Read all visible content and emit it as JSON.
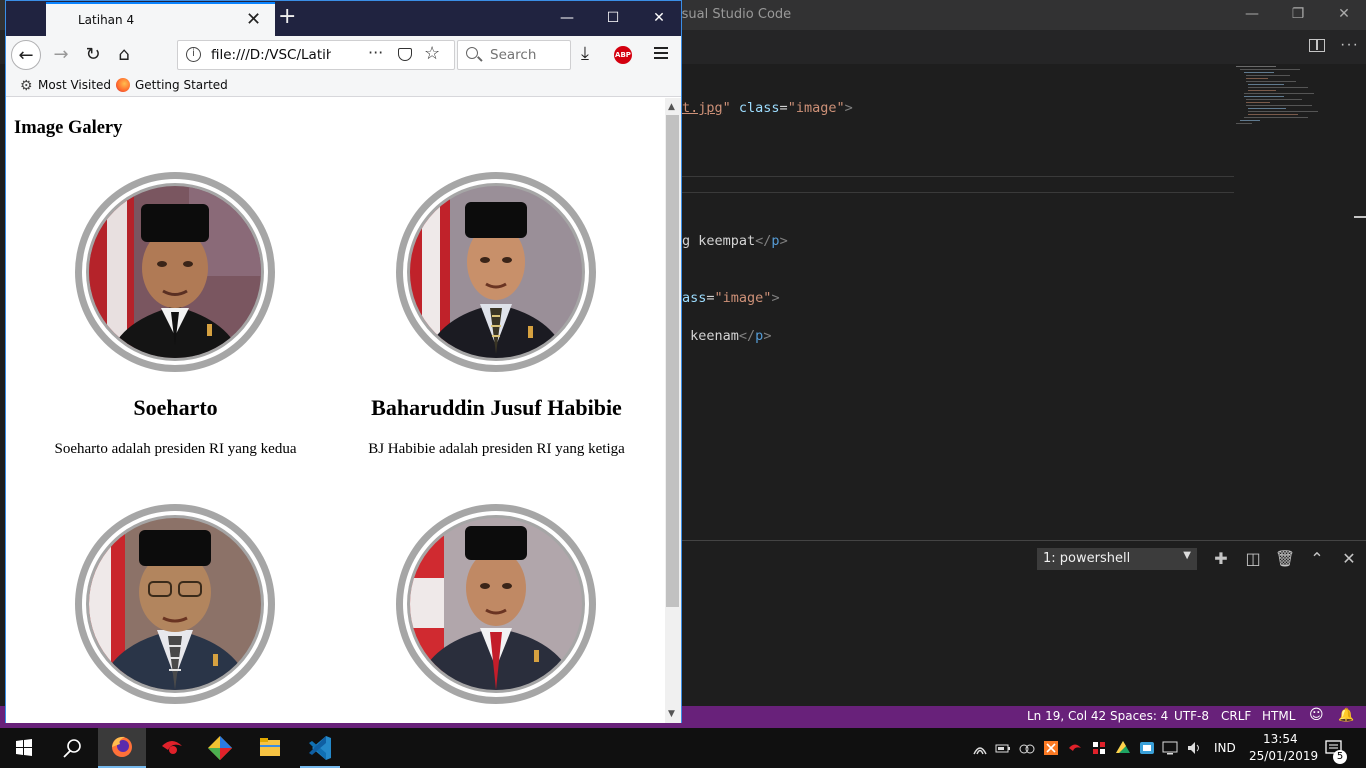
{
  "vscode": {
    "title": "isual Studio Code",
    "code_lines": [
      {
        "parts": [
          {
            "t": "t.jpg",
            "c": "c-link"
          },
          {
            "t": "\" ",
            "c": "c-str"
          },
          {
            "t": "class",
            "c": "c-attr"
          },
          {
            "t": "=",
            "c": ""
          },
          {
            "t": "\"image\"",
            "c": "c-str"
          },
          {
            "t": ">",
            "c": "c-tag"
          }
        ]
      },
      {
        "parts": [
          {
            "t": "g keempat",
            "c": ""
          },
          {
            "t": "</",
            "c": "c-tag"
          },
          {
            "t": "p",
            "c": "c-tagname"
          },
          {
            "t": ">",
            "c": "c-tag"
          }
        ]
      },
      {
        "parts": [
          {
            "t": "ass",
            "c": "c-attr"
          },
          {
            "t": "=",
            "c": ""
          },
          {
            "t": "\"image\"",
            "c": "c-str"
          },
          {
            "t": ">",
            "c": "c-tag"
          }
        ]
      },
      {
        "parts": [
          {
            "t": " keenam",
            "c": ""
          },
          {
            "t": "</",
            "c": "c-tag"
          },
          {
            "t": "p",
            "c": "c-tagname"
          },
          {
            "t": ">",
            "c": "c-tag"
          }
        ]
      }
    ],
    "terminal_select": "1: powershell",
    "status": {
      "position": "Ln 19, Col 42",
      "spaces": "Spaces: 4",
      "encoding": "UTF-8",
      "eol": "CRLF",
      "language": "HTML"
    }
  },
  "firefox": {
    "tab_title": "Latihan 4",
    "url": "file:///D:/VSC/Latiha",
    "search_placeholder": "Search",
    "bookmarks": [
      "Most Visited",
      "Getting Started"
    ],
    "abp_label": "ABP"
  },
  "page": {
    "title": "Image Galery",
    "cards": [
      {
        "name": "Soeharto",
        "desc": "Soeharto adalah presiden RI yang kedua"
      },
      {
        "name": "Baharuddin Jusuf Habibie",
        "desc": "BJ Habibie adalah presiden RI yang ketiga"
      },
      {
        "name": "",
        "desc": ""
      },
      {
        "name": "",
        "desc": ""
      }
    ]
  },
  "taskbar": {
    "language": "IND",
    "time": "13:54",
    "date": "25/01/2019",
    "notifications": "5"
  },
  "colors": {
    "vscode_statusbar": "#68217a",
    "firefox_titlebar": "#202340",
    "accent_blue": "#0a84ff"
  }
}
